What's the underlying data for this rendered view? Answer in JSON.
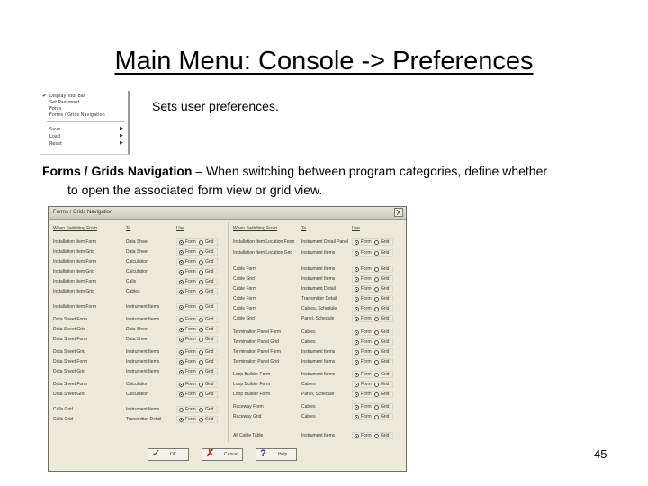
{
  "slide": {
    "title": "Main Menu:  Console -> Preferences",
    "description": "Sets user preferences.",
    "para_bold": "Forms / Grids Navigation",
    "para_text_1": " – When switching between program categories, define whether",
    "para_text_2": "to open the associated form view or grid view.",
    "page_number": "45"
  },
  "menu": {
    "check_glyph": "✔",
    "items": [
      {
        "label": "Display Tool Bar"
      },
      {
        "label": "Set Password"
      },
      {
        "label": "Fonts"
      },
      {
        "label": "Forms / Grids Navigation"
      },
      {
        "label": "Save"
      },
      {
        "label": "Load"
      },
      {
        "label": "Reset"
      }
    ],
    "arrow_glyph": "▶"
  },
  "dialog": {
    "title": "Forms / Grids Navigation",
    "close_label": "X",
    "col_when": "When Switching From",
    "col_to": "To",
    "col_use": "Use",
    "opt_form": "Form",
    "opt_grid": "Grid",
    "left_rows": [
      {
        "from": "Installation Item Form",
        "to": "Data Sheet",
        "sel": "form"
      },
      {
        "from": "Installation Item Grid",
        "to": "Data Sheet",
        "sel": "form"
      },
      {
        "from": "Installation Item Form",
        "to": "Calculation",
        "sel": "form"
      },
      {
        "from": "Installation Item Grid",
        "to": "Calculation",
        "sel": "form"
      },
      {
        "from": "Installation Item Form",
        "to": "Calls",
        "sel": "form"
      },
      {
        "from": "Installation Item Grid",
        "to": "Cables",
        "sel": "form"
      },
      {
        "from": "Installation Item Form",
        "to": "Instrument Items",
        "sel": "form"
      },
      {
        "from": "Data Sheet Form",
        "to": "Instrument Items",
        "sel": "form"
      },
      {
        "from": "Data Sheet Grid",
        "to": "Data Sheet",
        "sel": "form"
      },
      {
        "from": "Data Sheet Form",
        "to": "Data Sheet",
        "sel": "form"
      },
      {
        "from": "Data Sheet Grid",
        "to": "Instrument Items",
        "sel": "form"
      },
      {
        "from": "Data Sheet Form",
        "to": "Instrument Items",
        "sel": "form"
      },
      {
        "from": "Data Sheet Grid",
        "to": "Instrument Items",
        "sel": "form"
      },
      {
        "from": "Data Sheet Form",
        "to": "Calculation",
        "sel": "form"
      },
      {
        "from": "Data Sheet Grid",
        "to": "Calculation",
        "sel": "form"
      },
      {
        "from": "Calls Grid",
        "to": "Instrument Items",
        "sel": "form"
      },
      {
        "from": "Calls Grid",
        "to": "Transmitter Detail",
        "sel": "form"
      }
    ],
    "right_rows": [
      {
        "from": "Installation Item Location Form",
        "to": "Instrument Detail Panel",
        "sel": "form"
      },
      {
        "from": "Installation Item Location Grid",
        "to": "Instrument Items",
        "sel": "form"
      },
      {
        "from": "Cable Form",
        "to": "Instrument Items",
        "sel": "form"
      },
      {
        "from": "Cable Grid",
        "to": "Instrument Items",
        "sel": "form"
      },
      {
        "from": "Cable Form",
        "to": "Instrument Detail",
        "sel": "form"
      },
      {
        "from": "Cable Form",
        "to": "Transmitter Detail",
        "sel": "form"
      },
      {
        "from": "Cable Form",
        "to": "Cables, Schedule",
        "sel": "form"
      },
      {
        "from": "Cable Grid",
        "to": "Panel, Schedule",
        "sel": "form"
      },
      {
        "from": "Termination Panel Form",
        "to": "Cables",
        "sel": "form"
      },
      {
        "from": "Termination Panel Grid",
        "to": "Cables",
        "sel": "form"
      },
      {
        "from": "Termination Panel Form",
        "to": "Instrument Items",
        "sel": "form"
      },
      {
        "from": "Termination Panel Grid",
        "to": "Instrument Items",
        "sel": "form"
      },
      {
        "from": "Loop Builder Form",
        "to": "Instrument Items",
        "sel": "form"
      },
      {
        "from": "Loop Builder Form",
        "to": "Cables",
        "sel": "form"
      },
      {
        "from": "Loop Builder Form",
        "to": "Panel, Schedule",
        "sel": "form"
      },
      {
        "from": "Raceway Form",
        "to": "Cables",
        "sel": "form"
      },
      {
        "from": "Raceway Grid",
        "to": "Cables",
        "sel": "form"
      },
      {
        "from": "All Cable Table",
        "to": "Instrument Items",
        "sel": "form"
      }
    ],
    "buttons": {
      "ok_label": "OK",
      "cancel_label": "Cancel",
      "help_label": "Help",
      "ok_icon": "✓",
      "cancel_icon": "✗",
      "help_icon": "?"
    }
  }
}
